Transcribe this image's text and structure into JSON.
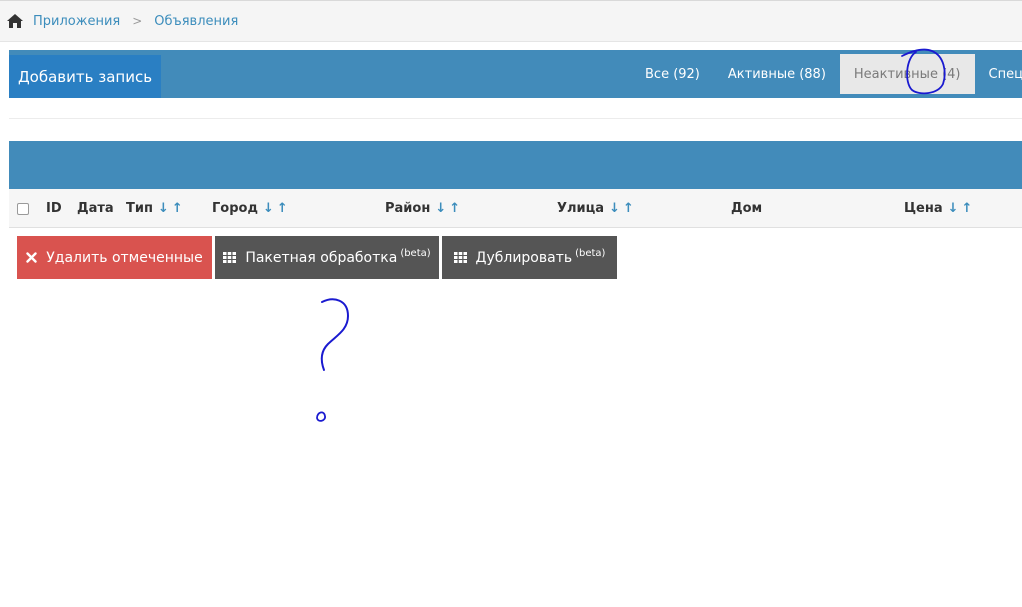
{
  "breadcrumb": {
    "items": [
      "Приложения",
      "Объявления"
    ],
    "separator": ">"
  },
  "toolbar": {
    "add_label": "Добавить запись"
  },
  "tabs": [
    {
      "label": "Все (92)",
      "active": false
    },
    {
      "label": "Активные (88)",
      "active": false
    },
    {
      "label": "Неактивные (4)",
      "active": true
    },
    {
      "label": "Спецпред",
      "active": false
    }
  ],
  "table": {
    "columns": [
      {
        "label": "ID",
        "sortable": false
      },
      {
        "label": "Дата",
        "sortable": false
      },
      {
        "label": "Тип",
        "sortable": true
      },
      {
        "label": "Город",
        "sortable": true
      },
      {
        "label": "Район",
        "sortable": true
      },
      {
        "label": "Улица",
        "sortable": true
      },
      {
        "label": "Дом",
        "sortable": false
      },
      {
        "label": "Цена",
        "sortable": true
      }
    ],
    "sort_arrows": "↓↑"
  },
  "actions": {
    "delete_label": "Удалить отмеченные",
    "batch_label": "Пакетная обработка",
    "duplicate_label": "Дублировать",
    "beta_label": "(beta)"
  },
  "colors": {
    "primary": "#428bba",
    "add_button": "#2a7fc3",
    "danger": "#d9534f",
    "dark_button": "#555555",
    "link": "#3c8dbc",
    "annotation": "#1a1ad0"
  },
  "icons": {
    "home": "home-icon",
    "delete": "close-icon",
    "grid": "grid-icon"
  }
}
